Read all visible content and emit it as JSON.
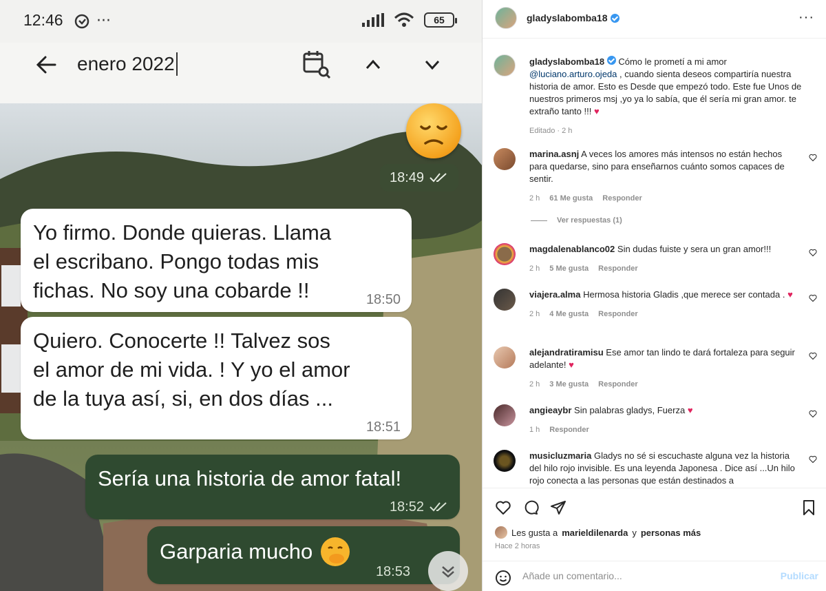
{
  "status_bar": {
    "time": "12:46",
    "dots": "···",
    "battery": "65"
  },
  "chat_search": {
    "query": "enero 2022"
  },
  "chat": {
    "emoji_time": "18:49",
    "messages": [
      {
        "text1": "Yo  firmo. Donde quieras. Llama",
        "text2": "el escribano. Pongo todas mis",
        "text3": "fichas. No soy una cobarde !!",
        "time": "18:50"
      },
      {
        "text1": "Quiero. Conocerte !!   Talvez sos",
        "text2": "el amor de mi vida. ! Y yo el amor",
        "text3": "de la tuya así, si,  en dos días ...",
        "time": "18:51"
      },
      {
        "text1": "Sería una historia de amor fatal!",
        "time": "18:52"
      },
      {
        "text1": "Garparia mucho",
        "time": "18:53"
      }
    ]
  },
  "post": {
    "author": "gladyslabomba18",
    "caption": {
      "username": "gladyslabomba18",
      "part1": "Cómo le prometí a mi amor",
      "mention": "@luciano.arturo.ojeda",
      "part2": ", cuando sienta deseos compartiría nuestra historia de amor. Esto es Desde que empezó todo. Este fue Unos de nuestros primeros msj ,yo ya lo sabía, que él sería mi gran amor.",
      "part3": "te extraño tanto !!!",
      "edited": "Editado · 2 h"
    },
    "comments": [
      {
        "user": "marina.asnj",
        "text": "A veces los amores más intensos no están hechos para quedarse, sino para enseñarnos cuánto somos capaces de sentir.",
        "time": "2 h",
        "likes": "61 Me gusta",
        "reply": "Responder"
      },
      {
        "user": "magdalenablanco02",
        "text": "Sin dudas fuiste y sera un gran amor!!!",
        "time": "2 h",
        "likes": "5 Me gusta",
        "reply": "Responder"
      },
      {
        "user": "viajera.alma",
        "text": "Hermosa historia Gladis ,que merece ser contada .",
        "time": "2 h",
        "likes": "4 Me gusta",
        "reply": "Responder"
      },
      {
        "user": "alejandratiramisu",
        "text": "Ese amor tan lindo te dará fortaleza para seguir adelante!",
        "time": "2 h",
        "likes": "3 Me gusta",
        "reply": "Responder"
      },
      {
        "user": "angieaybr",
        "text": "Sin palabras gladys, Fuerza",
        "time": "1 h",
        "reply": "Responder"
      },
      {
        "user": "musicluzmaria",
        "text": "Gladys no sé si escuchaste alguna vez la historia del hilo rojo invisible. Es una leyenda Japonesa . Dice así ...Un hilo rojo conecta a las personas que están destinados a"
      }
    ],
    "view_replies": "Ver respuestas (1)",
    "likes": {
      "prefix": "Les gusta a",
      "user": "marieldilenarda",
      "conj": "y",
      "rest": "personas más"
    },
    "time_ago": "Hace 2 horas",
    "add_comment_placeholder": "Añade un comentario...",
    "publish_label": "Publicar"
  }
}
